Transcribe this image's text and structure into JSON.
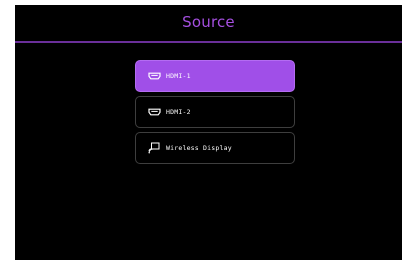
{
  "header": {
    "title": "Source"
  },
  "sources": [
    {
      "label": "HDMI-1",
      "icon": "hdmi-icon",
      "selected": true
    },
    {
      "label": "HDMI-2",
      "icon": "hdmi-icon",
      "selected": false
    },
    {
      "label": "Wireless Display",
      "icon": "wireless-display-icon",
      "selected": false
    }
  ],
  "colors": {
    "accent": "#a04fe8",
    "title": "#a54fe0",
    "background": "#000000",
    "item_border": "#3e3e3e"
  }
}
